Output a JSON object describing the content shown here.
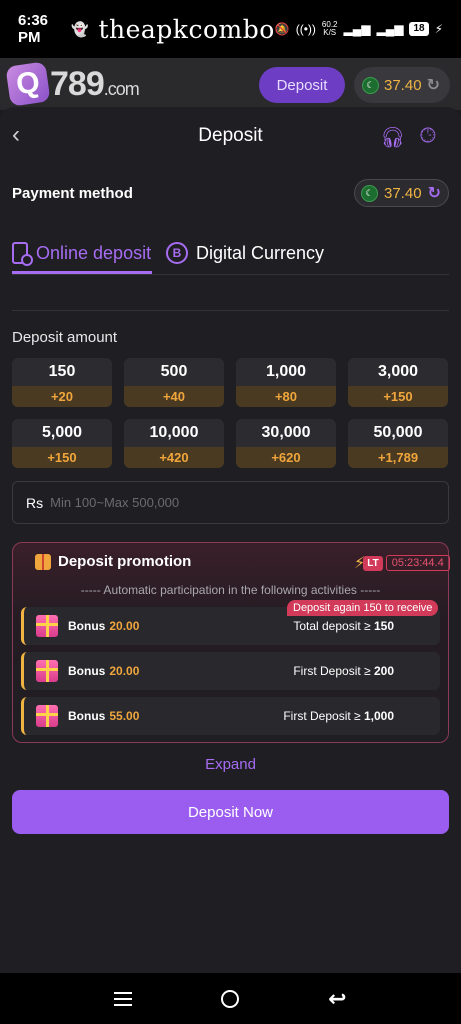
{
  "status_bar": {
    "time": "6:36 PM",
    "watermark": "theapkcombo",
    "net_speed_top": "60.2",
    "net_speed_bottom": "K/S",
    "battery": "18"
  },
  "app_header": {
    "logo_text": "789",
    "logo_suffix": ".com",
    "logo_q": "Q",
    "deposit_label": "Deposit",
    "balance": "37.40"
  },
  "page": {
    "title": "Deposit",
    "payment_method_label": "Payment method",
    "balance": "37.40"
  },
  "tabs": [
    {
      "label": "Online deposit",
      "active": true
    },
    {
      "label": "Digital Currency",
      "active": false
    }
  ],
  "deposit_amount_label": "Deposit amount",
  "amounts": [
    {
      "value": "150",
      "bonus": "+20"
    },
    {
      "value": "500",
      "bonus": "+40"
    },
    {
      "value": "1,000",
      "bonus": "+80"
    },
    {
      "value": "3,000",
      "bonus": "+150"
    },
    {
      "value": "5,000",
      "bonus": "+150"
    },
    {
      "value": "10,000",
      "bonus": "+420"
    },
    {
      "value": "30,000",
      "bonus": "+620"
    },
    {
      "value": "50,000",
      "bonus": "+1,789"
    }
  ],
  "amount_input": {
    "currency": "Rs",
    "placeholder": "Min 100~Max 500,000",
    "value": ""
  },
  "promotion": {
    "title": "Deposit promotion",
    "lt_badge": "LT",
    "countdown": "05:23:44.4",
    "subtitle": "----- Automatic participation in the following activities -----",
    "again_tag": "Deposit again 150 to receive",
    "rows": [
      {
        "label": "Bonus",
        "amount": "20.00",
        "condition": "Total deposit ≥",
        "threshold": "150"
      },
      {
        "label": "Bonus",
        "amount": "20.00",
        "condition": "First Deposit ≥",
        "threshold": "200"
      },
      {
        "label": "Bonus",
        "amount": "55.00",
        "condition": "First Deposit ≥",
        "threshold": "1,000"
      }
    ]
  },
  "expand_label": "Expand",
  "deposit_now_label": "Deposit Now",
  "colors": {
    "accent": "#9b5cf0",
    "gold": "#f0a63c",
    "alert": "#d23a5a"
  }
}
